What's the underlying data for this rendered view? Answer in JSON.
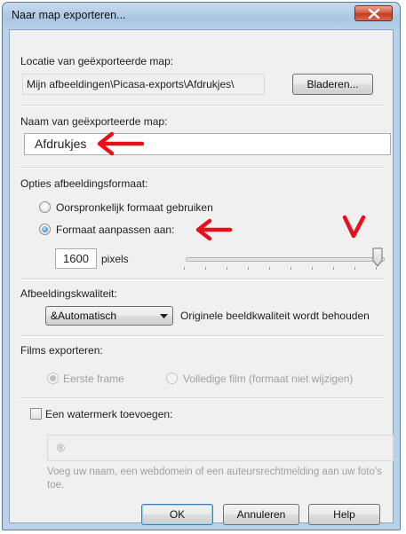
{
  "window": {
    "title": "Naar map exporteren...",
    "close_glyph": "x"
  },
  "location": {
    "label": "Locatie van geëxporteerde map:",
    "path": "Mijn afbeeldingen\\Picasa-exports\\Afdrukjes\\",
    "browse_button": "Bladeren..."
  },
  "folder_name": {
    "label": "Naam van geëxporteerde map:",
    "value": "Afdrukjes"
  },
  "image_format": {
    "label": "Opties afbeeldingsformaat:",
    "option_original": "Oorspronkelijk formaat gebruiken",
    "option_resize": "Formaat aanpassen aan:",
    "selected": "option_resize",
    "size_value": "1600",
    "size_unit": "pixels",
    "slider_fraction": 1.0
  },
  "quality": {
    "label": "Afbeeldingskwaliteit:",
    "selected_value": "&Automatisch",
    "description": "Originele beeldkwaliteit wordt behouden"
  },
  "movies": {
    "label": "Films exporteren:",
    "option_first_frame": "Eerste frame",
    "option_full_movie": "Volledige film (formaat niet wijzigen)",
    "selected": "option_first_frame"
  },
  "watermark": {
    "checkbox_label": "Een watermerk toevoegen:",
    "checked": false,
    "value": "®",
    "help": "Voeg uw naam, een webdomein of een auteursrechtmelding aan uw foto's toe."
  },
  "buttons": {
    "ok": "OK",
    "cancel": "Annuleren",
    "help": "Help"
  },
  "annotation_color": "#e8101a",
  "icons": [
    "close-icon",
    "dropdown-arrow-icon",
    "slider-thumb-icon",
    "red-arrow-icon",
    "red-v-marker-icon"
  ]
}
